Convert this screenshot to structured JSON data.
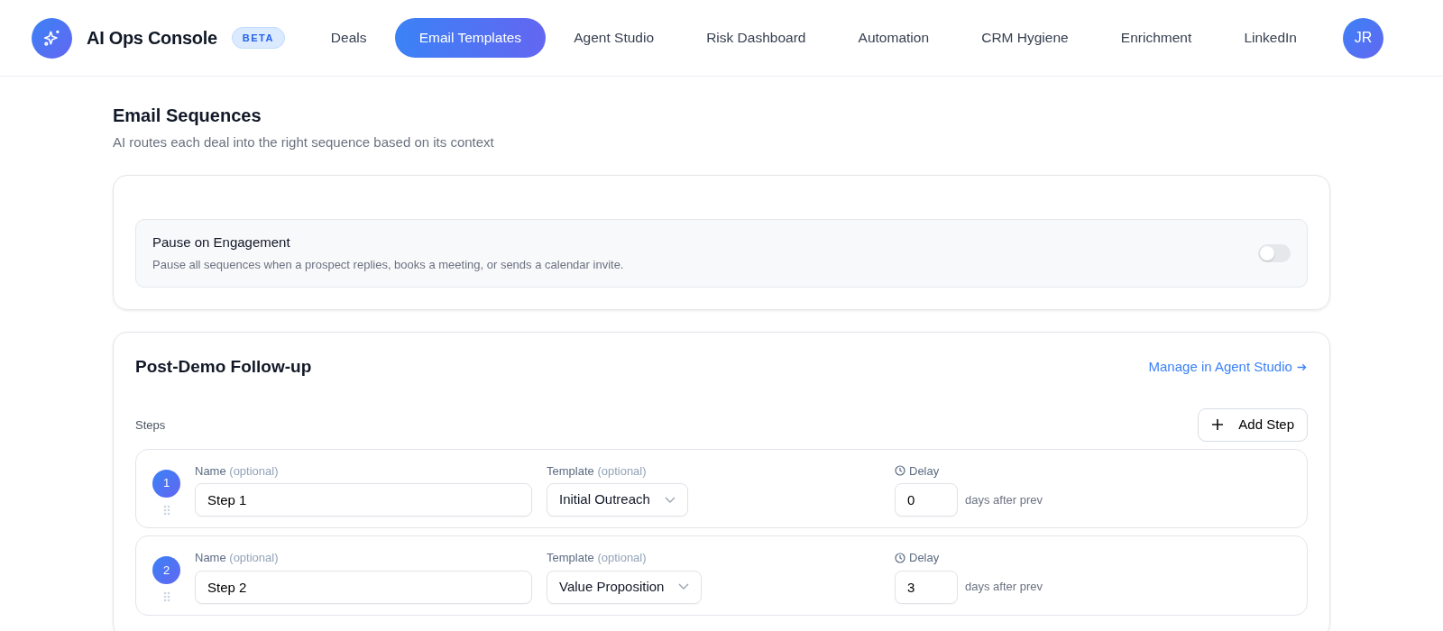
{
  "brand": {
    "name": "AI Ops Console",
    "badge": "BETA"
  },
  "nav": [
    {
      "label": "Deals",
      "selected": false
    },
    {
      "label": "Email Templates",
      "selected": true
    },
    {
      "label": "Agent Studio",
      "selected": false
    },
    {
      "label": "Risk Dashboard",
      "selected": false
    },
    {
      "label": "Automation",
      "selected": false
    },
    {
      "label": "CRM Hygiene",
      "selected": false
    },
    {
      "label": "Enrichment",
      "selected": false
    },
    {
      "label": "LinkedIn",
      "selected": false
    }
  ],
  "avatar": "JR",
  "page": {
    "title": "Email Sequences",
    "subtitle": "AI routes each deal into the right sequence based on its context"
  },
  "pause_setting": {
    "title": "Pause on Engagement",
    "description": "Pause all sequences when a prospect replies, books a meeting, or sends a calendar invite.",
    "on": false
  },
  "sequence": {
    "title": "Post-Demo Follow-up",
    "link": "Manage in Agent Studio",
    "steps_label": "Steps",
    "add_button": "Add Step",
    "steps": [
      {
        "number": "1",
        "name_label": "Name",
        "name_hint": "(optional)",
        "name": "Step 1",
        "template_label": "Template",
        "template_hint": "(optional)",
        "template": "Initial Outreach",
        "delay_label": "Delay",
        "delay": "0",
        "delay_suffix": "days after prev"
      },
      {
        "number": "2",
        "name_label": "Name",
        "name_hint": "(optional)",
        "name": "Step 2",
        "template_label": "Template",
        "template_hint": "(optional)",
        "template": "Value Proposition",
        "delay_label": "Delay",
        "delay": "3",
        "delay_suffix": "days after prev"
      }
    ]
  }
}
